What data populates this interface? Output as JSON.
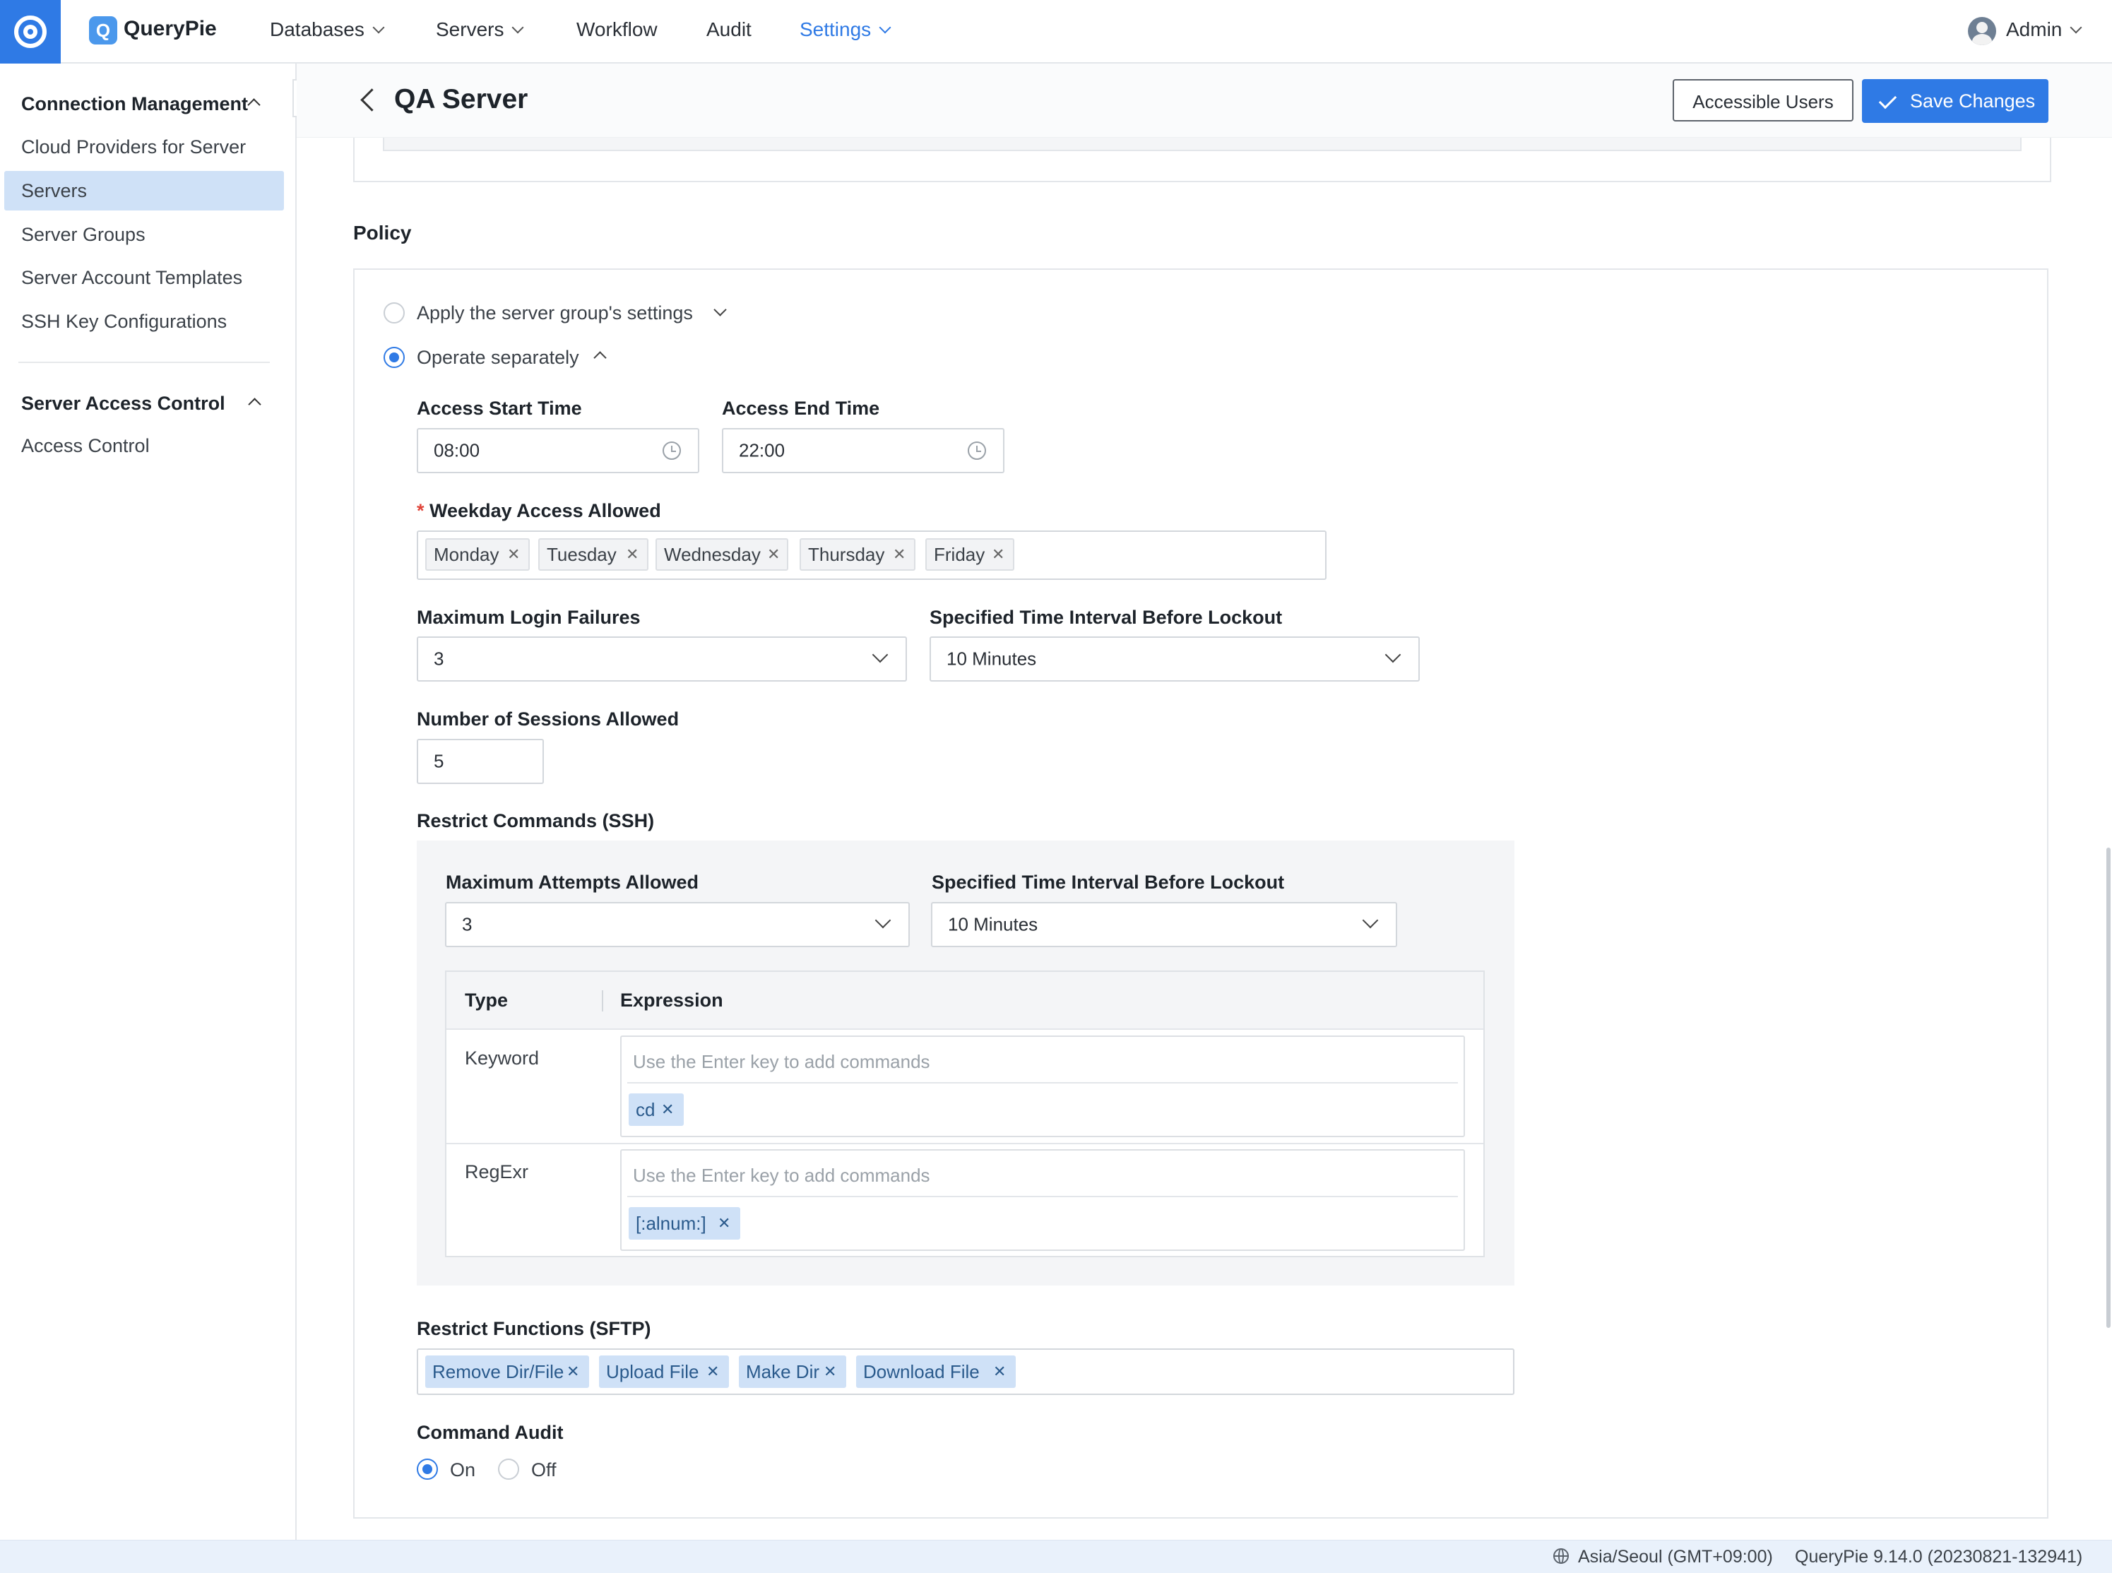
{
  "topbar": {
    "brand": "QueryPie",
    "brand_badge": "Q",
    "nav": [
      "Databases",
      "Servers",
      "Workflow",
      "Audit",
      "Settings"
    ],
    "active_nav": "Settings",
    "user": "Admin"
  },
  "sidebar": {
    "sections": [
      {
        "title": "Connection Management",
        "items": [
          "Cloud Providers for Server",
          "Servers",
          "Server Groups",
          "Server Account Templates",
          "SSH Key Configurations"
        ]
      },
      {
        "title": "Server Access Control",
        "items": [
          "Access Control"
        ]
      }
    ],
    "selected": "Servers"
  },
  "header": {
    "title": "QA Server",
    "accessible_users": "Accessible Users",
    "save_changes": "Save Changes"
  },
  "policy": {
    "title": "Policy",
    "option_group": "Apply the server group's settings",
    "option_separate": "Operate separately",
    "selected_option": "Operate separately",
    "access_start_label": "Access Start Time",
    "access_start_value": "08:00",
    "access_end_label": "Access End Time",
    "access_end_value": "22:00",
    "weekday_label": "Weekday Access Allowed",
    "weekdays": [
      "Monday",
      "Tuesday",
      "Wednesday",
      "Thursday",
      "Friday"
    ],
    "max_login_label": "Maximum Login Failures",
    "max_login_value": "3",
    "lockout_label": "Specified Time Interval Before Lockout",
    "lockout_value": "10 Minutes",
    "sessions_label": "Number of Sessions Allowed",
    "sessions_value": "5",
    "ssh": {
      "title": "Restrict Commands (SSH)",
      "max_attempts_label": "Maximum Attempts Allowed",
      "max_attempts_value": "3",
      "lockout_label": "Specified Time Interval Before Lockout",
      "lockout_value": "10 Minutes",
      "col_type": "Type",
      "col_expression": "Expression",
      "rows": [
        {
          "type": "Keyword",
          "placeholder": "Use the Enter key to add commands",
          "tags": [
            "cd"
          ]
        },
        {
          "type": "RegExr",
          "placeholder": "Use the Enter key to add commands",
          "tags": [
            "[:alnum:]"
          ]
        }
      ]
    },
    "sftp": {
      "title": "Restrict Functions (SFTP)",
      "tags": [
        "Remove Dir/File",
        "Upload File",
        "Make Dir",
        "Download File"
      ]
    },
    "audit": {
      "title": "Command Audit",
      "on": "On",
      "off": "Off",
      "selected": "On"
    }
  },
  "footer": {
    "timezone": "Asia/Seoul (GMT+09:00)",
    "version": "QueryPie 9.14.0 (20230821-132941)"
  },
  "colors": {
    "accent": "#2f7ae5",
    "selected_bg": "#cfe1f7",
    "panel_bg": "#f4f5f7",
    "required": "#e0453a"
  }
}
